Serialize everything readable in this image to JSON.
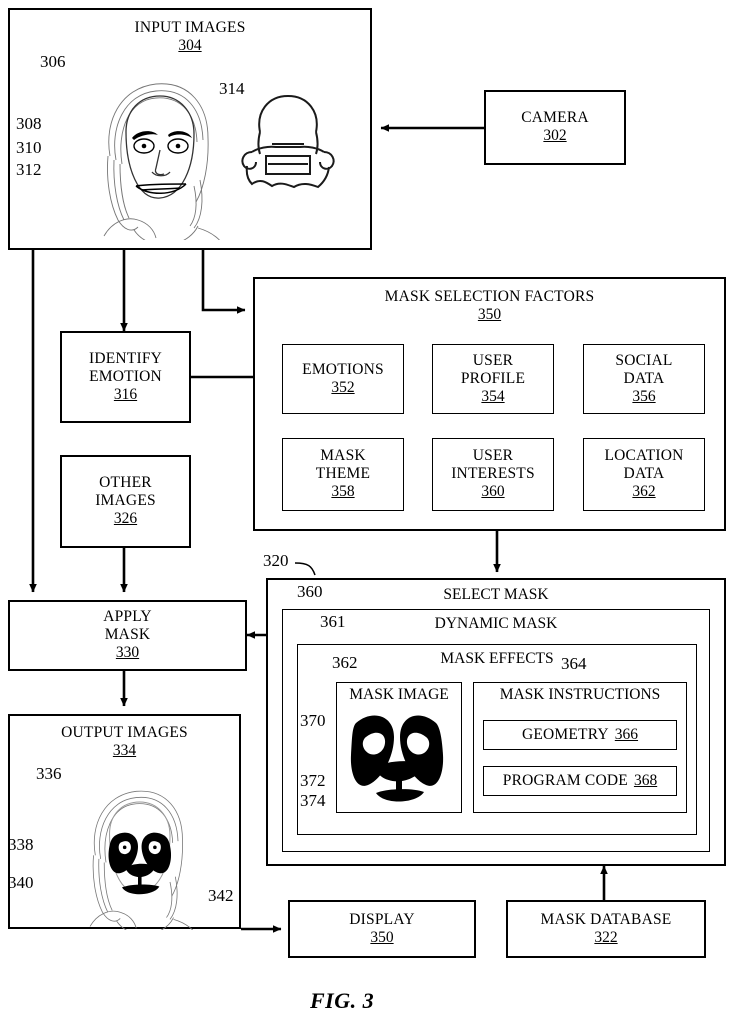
{
  "figure": {
    "caption": "FIG. 3"
  },
  "boxes": {
    "input_images": {
      "title": "INPUT IMAGES",
      "num": "304"
    },
    "camera": {
      "title": "CAMERA",
      "num": "302"
    },
    "identify_emotion": {
      "title_line1": "IDENTIFY",
      "title_line2": "EMOTION",
      "num": "316"
    },
    "other_images": {
      "title_line1": "OTHER",
      "title_line2": "IMAGES",
      "num": "326"
    },
    "apply_mask": {
      "title_line1": "APPLY",
      "title_line2": "MASK",
      "num": "330"
    },
    "output_images": {
      "title": "OUTPUT IMAGES",
      "num": "334"
    },
    "display": {
      "title": "DISPLAY",
      "num": "350"
    },
    "mask_database": {
      "title": "MASK DATABASE",
      "num": "322"
    },
    "mask_selection_factors": {
      "title": "MASK SELECTION FACTORS",
      "num": "350"
    },
    "select_mask": {
      "title": "SELECT MASK",
      "ref": "320"
    },
    "dynamic_mask": {
      "title": "DYNAMIC MASK",
      "ref": "360"
    },
    "mask_effects": {
      "title": "MASK EFFECTS",
      "ref": "361"
    },
    "mask_image": {
      "title": "MASK IMAGE",
      "ref": "362"
    },
    "mask_instructions": {
      "title": "MASK INSTRUCTIONS",
      "ref": "364"
    },
    "geometry": {
      "title": "GEOMETRY",
      "num": "366"
    },
    "program_code": {
      "title": "PROGRAM CODE",
      "num": "368"
    }
  },
  "factors": [
    {
      "lines": [
        "EMOTIONS"
      ],
      "num": "352"
    },
    {
      "lines": [
        "USER",
        "PROFILE"
      ],
      "num": "354"
    },
    {
      "lines": [
        "SOCIAL",
        "DATA"
      ],
      "num": "356"
    },
    {
      "lines": [
        "MASK",
        "THEME"
      ],
      "num": "358"
    },
    {
      "lines": [
        "USER",
        "INTERESTS"
      ],
      "num": "360"
    },
    {
      "lines": [
        "LOCATION",
        "DATA"
      ],
      "num": "362"
    }
  ],
  "reference_labels": {
    "r306": "306",
    "r308": "308",
    "r310": "310",
    "r312": "312",
    "r314": "314",
    "r336": "336",
    "r338": "338",
    "r340": "340",
    "r342": "342",
    "r370": "370",
    "r372": "372",
    "r374": "374"
  },
  "colors": {
    "line": "#000000",
    "background": "#ffffff",
    "illustration": "#555555"
  }
}
